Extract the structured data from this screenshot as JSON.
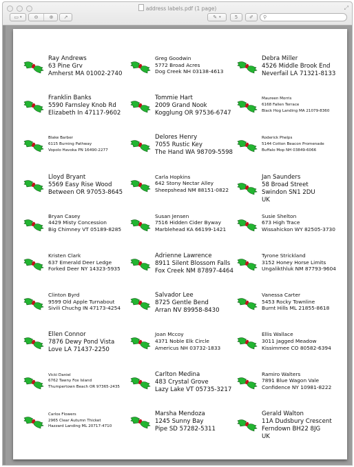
{
  "window": {
    "title": "address labels.pdf (1 page)",
    "icons": {
      "doc": "pdf-document-icon",
      "resize": "fullscreen-icon"
    }
  },
  "toolbar": {
    "view_menu": "sidebar-view-icon",
    "view_menu_arrow": "▾",
    "zoom_out": "zoom-out-icon",
    "zoom_in": "zoom-in-icon",
    "share": "share-icon",
    "annotate": "pen-icon",
    "annotate_arrow": "▾",
    "rotate": "5",
    "edit": "edit-icon",
    "search_placeholder": "",
    "search_value": ""
  },
  "labels": [
    {
      "col": 0,
      "row": 0,
      "size": "large",
      "lines": [
        "Ray Andrews",
        "63 Pine Grv",
        "Amherst MA 01002-2740"
      ]
    },
    {
      "col": 1,
      "row": 0,
      "size": "medium",
      "lines": [
        "Greg Goodwin",
        "5772 Broad Acres",
        "Dog Creek NH 03138-4613"
      ]
    },
    {
      "col": 2,
      "row": 0,
      "size": "large",
      "lines": [
        "Debra Miller",
        "4526 Middle Brook End",
        "Neverfail LA 71321-8133"
      ]
    },
    {
      "col": 0,
      "row": 1,
      "size": "large",
      "lines": [
        "Franklin Banks",
        "5590 Farnsley Knob Rd",
        "Elizabeth In 47117-9602"
      ]
    },
    {
      "col": 1,
      "row": 1,
      "size": "large",
      "lines": [
        "Tommie Hart",
        "2009 Grand Nook",
        "Kogglung OR 97536-6747"
      ]
    },
    {
      "col": 2,
      "row": 1,
      "size": "small",
      "lines": [
        "Maureen Morris",
        "6168 Fallen Terrace",
        "Black Hog Landing MA 21079-8360"
      ]
    },
    {
      "col": 0,
      "row": 2,
      "size": "small",
      "lines": [
        "Blake Barber",
        "6115 Burning Pathway",
        "Vopolo Havoka PN 16490-2277"
      ]
    },
    {
      "col": 1,
      "row": 2,
      "size": "large",
      "lines": [
        "Delores Henry",
        "7055 Rustic Key",
        "The Hand WA 98709-5598"
      ]
    },
    {
      "col": 2,
      "row": 2,
      "size": "small",
      "lines": [
        "Roderick  Phelps",
        "5144 Cotton Beacon Promenade",
        "Buffalo Mop NH 03849-6066"
      ]
    },
    {
      "col": 0,
      "row": 3,
      "size": "large",
      "lines": [
        "Lloyd Bryant",
        "5569 Easy Rise Wood",
        "Between OR 97053-8645"
      ]
    },
    {
      "col": 1,
      "row": 3,
      "size": "medium",
      "lines": [
        "Carla Hopkins",
        "642 Stony Nectar Alley",
        "Sheepshead NM 88151-0822"
      ]
    },
    {
      "col": 2,
      "row": 3,
      "size": "large",
      "lines": [
        "Jan Saunders",
        "58 Broad Street",
        "Swindon  SN1 2DU",
        "UK"
      ]
    },
    {
      "col": 0,
      "row": 4,
      "size": "medium",
      "lines": [
        "Bryan Casey",
        "4429 Misty Concession",
        "Big Chimney VT 05189-8285"
      ]
    },
    {
      "col": 1,
      "row": 4,
      "size": "medium",
      "lines": [
        "Susan Jensen",
        "7516 Hidden Cider Byway",
        "Marblehead KA 66199-1421"
      ]
    },
    {
      "col": 2,
      "row": 4,
      "size": "medium",
      "lines": [
        "Susie Shelton",
        "673 High Trace",
        "Wissahickon WY 82505-3730"
      ]
    },
    {
      "col": 0,
      "row": 5,
      "size": "medium",
      "lines": [
        "Kristen Clark",
        "637 Emerald Deer Ledge",
        "Forked Deer NY 14323-5935"
      ]
    },
    {
      "col": 1,
      "row": 5,
      "size": "large",
      "lines": [
        "Adrienne Lawrence",
        "8911 Silent Blossom Falls",
        "Fox Creek NM 87897-4464"
      ]
    },
    {
      "col": 2,
      "row": 5,
      "size": "medium",
      "lines": [
        "Tyrone Strickland",
        "3152 Honey Horse Limits",
        "Ungalikthluk NM 87793-9604"
      ]
    },
    {
      "col": 0,
      "row": 6,
      "size": "medium",
      "lines": [
        "Clinton Byrd",
        "9599 Old Apple Turnabout",
        "Sivili Chuchg IN 47173-4254"
      ]
    },
    {
      "col": 1,
      "row": 6,
      "size": "large",
      "lines": [
        "Salvador Lee",
        "8725 Gentle Bend",
        "Arran NV 89958-8430"
      ]
    },
    {
      "col": 2,
      "row": 6,
      "size": "medium",
      "lines": [
        "Vanessa Carter",
        "5453 Rocky Townline",
        "Burnt Hills ML 21855-8618"
      ]
    },
    {
      "col": 0,
      "row": 7,
      "size": "large",
      "lines": [
        "Ellen Connor",
        "7876 Dewy Pond Vista",
        "Love LA 71437-2250"
      ]
    },
    {
      "col": 1,
      "row": 7,
      "size": "medium",
      "lines": [
        "Joan Mccoy",
        "4371 Noble Elk Circle",
        "Americus NH 03732-1833"
      ]
    },
    {
      "col": 2,
      "row": 7,
      "size": "medium",
      "lines": [
        "Ellis Wallace",
        "3011 Jagged Meadow",
        "Kissimmee CO 80582-6394"
      ]
    },
    {
      "col": 0,
      "row": 8,
      "size": "small",
      "lines": [
        "Vicki Daniel",
        "6762 Tawny Fox Island",
        "Thumpertown Beach OR 97365-2435"
      ]
    },
    {
      "col": 1,
      "row": 8,
      "size": "large",
      "lines": [
        "Carlton Medina",
        "483 Crystal Grove",
        "Lazy Lake VT 05735-3217"
      ]
    },
    {
      "col": 2,
      "row": 8,
      "size": "medium",
      "lines": [
        "Ramiro Walters",
        "7891 Blue Wagon Vale",
        "Confidence NY 10981-8222"
      ]
    },
    {
      "col": 0,
      "row": 9,
      "size": "small",
      "lines": [
        "Carlos Flowers",
        "2965 Clear Autumn Thicket",
        "Hazzard Landing ML 20717-4710"
      ]
    },
    {
      "col": 1,
      "row": 9,
      "size": "large",
      "lines": [
        "Marsha Mendoza",
        "1245 Sunny Bay",
        "Pipe SD 57282-5311"
      ]
    },
    {
      "col": 2,
      "row": 9,
      "size": "large",
      "lines": [
        "Gerald Walton",
        "11A Dudsbury Crescent",
        "Ferndown  BH22 8JG",
        "UK"
      ]
    }
  ],
  "colors": {
    "holly_leaf": "#22b531",
    "holly_leaf_outline": "#0e5a14",
    "holly_berry": "#c0141c"
  }
}
